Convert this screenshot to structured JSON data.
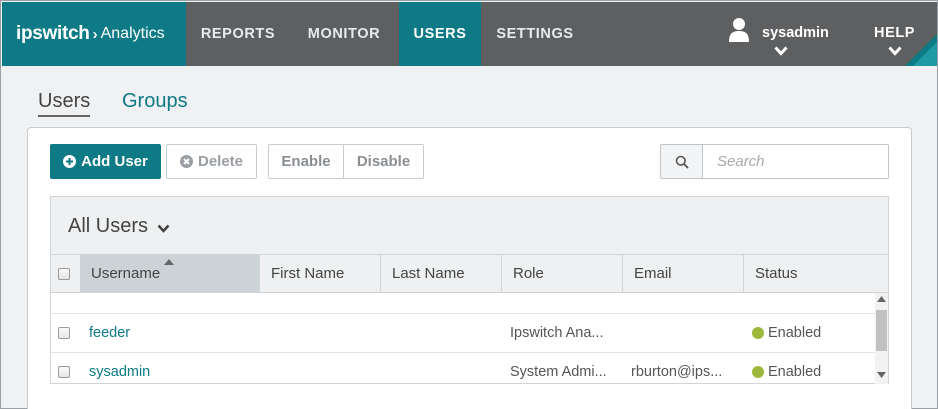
{
  "app": {
    "brand": "ipswitch",
    "product": "Analytics"
  },
  "nav": {
    "reports": "REPORTS",
    "monitor": "MONITOR",
    "users": "USERS",
    "settings": "SETTINGS",
    "active": "USERS"
  },
  "user_menu": {
    "username": "sysadmin",
    "help": "HELP"
  },
  "subtabs": {
    "users": "Users",
    "groups": "Groups",
    "active": "Users"
  },
  "toolbar": {
    "add_user": "Add User",
    "delete": "Delete",
    "enable": "Enable",
    "disable": "Disable"
  },
  "search": {
    "placeholder": "Search",
    "value": ""
  },
  "table": {
    "view_title": "All Users",
    "columns": [
      "Username",
      "First Name",
      "Last Name",
      "Role",
      "Email",
      "Status"
    ],
    "sorted_column": "Username",
    "sort_direction": "ascending",
    "rows": [
      {
        "username": "feeder",
        "first_name": "",
        "last_name": "",
        "role": "Ipswitch Ana...",
        "email": "",
        "status": "Enabled"
      },
      {
        "username": "sysadmin",
        "first_name": "",
        "last_name": "",
        "role": "System Admi...",
        "email": "rburton@ips...",
        "status": "Enabled"
      }
    ]
  },
  "colors": {
    "accent": "#0d7a85",
    "nav_bg": "#5e5f61",
    "status_enabled": "#9cb83a"
  }
}
